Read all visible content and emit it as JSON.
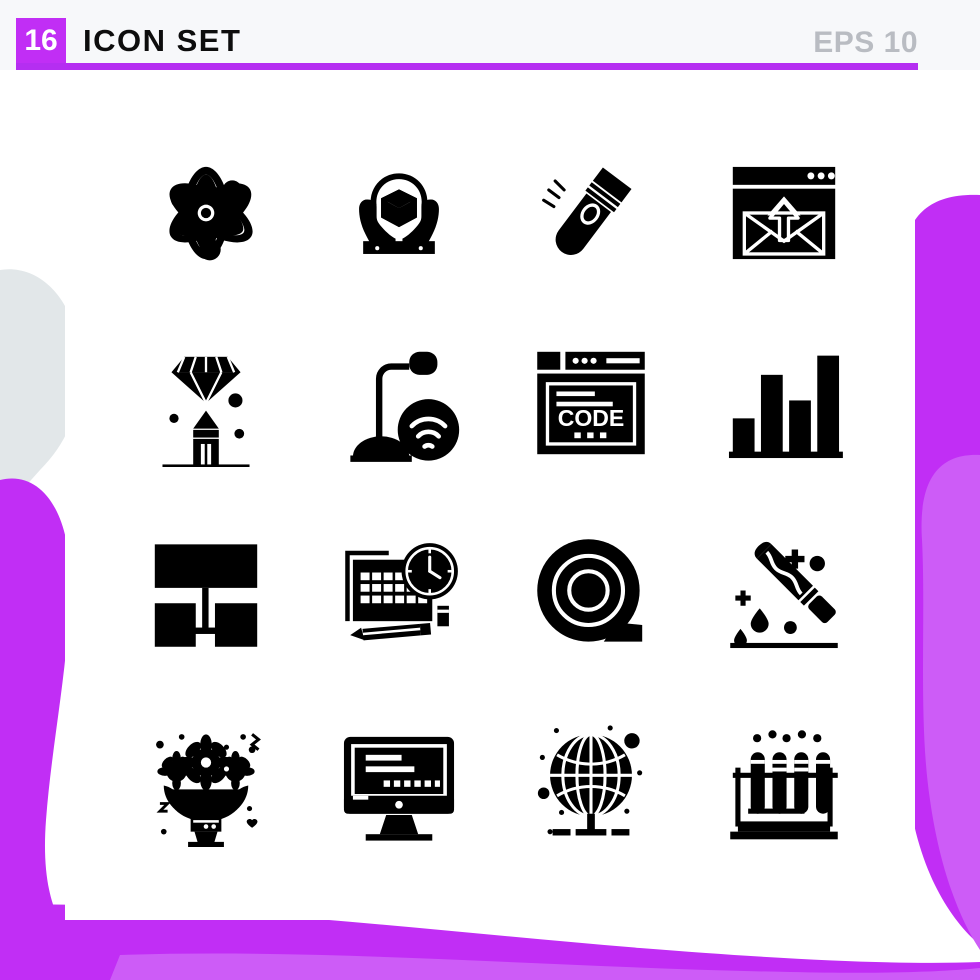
{
  "header": {
    "count": "16",
    "title": "ICON SET",
    "eps": "EPS 10",
    "accent_color": "#c12ef5",
    "rule_color": "#b52ef1",
    "background_color": "#f7f8fa"
  },
  "theme": {
    "icon_color": "#000000",
    "card_background": "#ffffff",
    "blob_purple": "#c12ef5",
    "blob_purple_light": "#cd5cf7",
    "blob_grey": "#e2e7e9"
  },
  "grid": {
    "columns": 4,
    "rows": 4,
    "icons": [
      {
        "name": "atom-icon",
        "label": "Atom"
      },
      {
        "name": "handle-with-care-icon",
        "label": "Handle With Care"
      },
      {
        "name": "flashlight-icon",
        "label": "Flashlight"
      },
      {
        "name": "send-mail-browser-icon",
        "label": "Send Mail"
      },
      {
        "name": "diamond-pencil-icon",
        "label": "Creative Quality"
      },
      {
        "name": "smart-lamp-wifi-icon",
        "label": "Smart Lamp"
      },
      {
        "name": "code-browser-icon",
        "label": "Code",
        "text": "CODE"
      },
      {
        "name": "bar-chart-icon",
        "label": "Bar Chart"
      },
      {
        "name": "sitemap-icon",
        "label": "Sitemap"
      },
      {
        "name": "calendar-schedule-icon",
        "label": "Schedule"
      },
      {
        "name": "tape-roll-icon",
        "label": "Tape Roll"
      },
      {
        "name": "bloody-knife-icon",
        "label": "Bloody Knife"
      },
      {
        "name": "flower-vase-icon",
        "label": "Flower Vase"
      },
      {
        "name": "desktop-monitor-icon",
        "label": "Desktop Monitor"
      },
      {
        "name": "globe-stand-icon",
        "label": "Global Network"
      },
      {
        "name": "test-tube-rack-icon",
        "label": "Test Tubes"
      }
    ]
  }
}
